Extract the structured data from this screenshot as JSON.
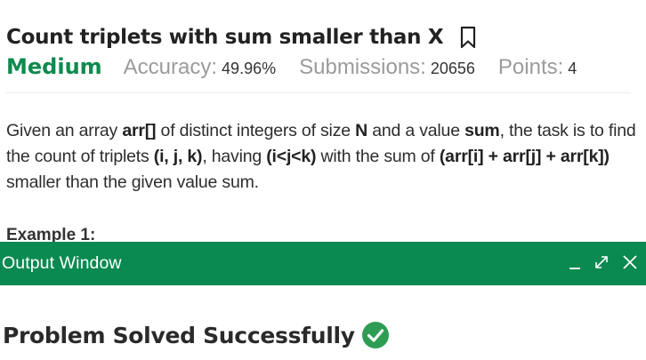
{
  "problem": {
    "title": "Count triplets with sum smaller than X",
    "difficulty": "Medium",
    "accuracy_label": "Accuracy:",
    "accuracy_value": "49.96%",
    "submissions_label": "Submissions:",
    "submissions_value": "20656",
    "points_label": "Points:",
    "points_value": "4"
  },
  "description": {
    "p1": "Given an array ",
    "b1": "arr[]",
    "p2": " of distinct integers of size ",
    "b2": "N",
    "p3": " and a value ",
    "b3": "sum",
    "p4": ", the task is to find the count of triplets ",
    "b4": "(i, j, k)",
    "p5": ", having ",
    "b5": "(i<j<k)",
    "p6": " with the sum of ",
    "b6": "(arr[i] + arr[j] + arr[k])",
    "p7": " smaller than the given value sum."
  },
  "example_heading": "Example 1:",
  "output_window": {
    "title": "Output Window",
    "result": "Problem Solved Successfully"
  },
  "colors": {
    "brand_green": "#0a8a50",
    "difficulty_green": "#0e8a4e",
    "success_green": "#2e9d53"
  },
  "icons": {
    "bookmark": "bookmark-icon",
    "minimize": "minimize-icon",
    "expand": "expand-icon",
    "close": "close-icon",
    "success": "check-circle-icon"
  }
}
